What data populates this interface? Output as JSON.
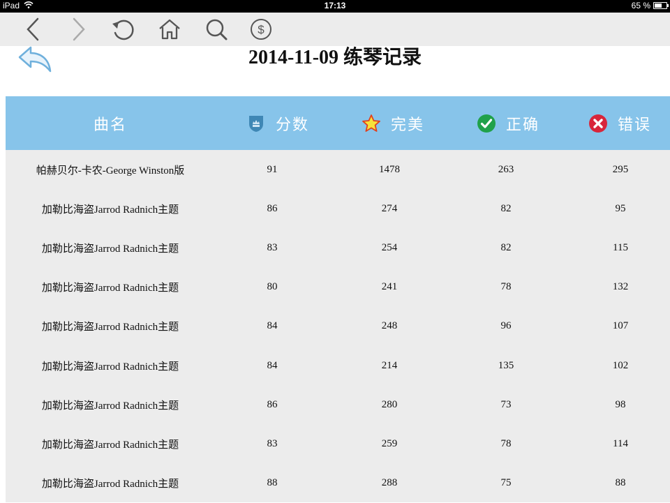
{
  "status_bar": {
    "device": "iPad",
    "time": "17:13",
    "battery": "65 %",
    "battery_level": 0.65
  },
  "toolbar": {
    "icons": [
      "back-icon",
      "forward-icon",
      "reload-icon",
      "home-icon",
      "search-icon",
      "dollar-icon"
    ]
  },
  "page": {
    "title": "2014-11-09 练琴记录"
  },
  "table": {
    "headers": {
      "name": "曲名",
      "score": "分数",
      "perfect": "完美",
      "correct": "正确",
      "error": "错误"
    },
    "rows": [
      {
        "name": "帕赫贝尔-卡农-George Winston版",
        "score": "91",
        "perfect": "1478",
        "correct": "263",
        "error": "295"
      },
      {
        "name": "加勒比海盗Jarrod Radnich主题",
        "score": "86",
        "perfect": "274",
        "correct": "82",
        "error": "95"
      },
      {
        "name": "加勒比海盗Jarrod Radnich主题",
        "score": "83",
        "perfect": "254",
        "correct": "82",
        "error": "115"
      },
      {
        "name": "加勒比海盗Jarrod Radnich主题",
        "score": "80",
        "perfect": "241",
        "correct": "78",
        "error": "132"
      },
      {
        "name": "加勒比海盗Jarrod Radnich主题",
        "score": "84",
        "perfect": "248",
        "correct": "96",
        "error": "107"
      },
      {
        "name": "加勒比海盗Jarrod Radnich主题",
        "score": "84",
        "perfect": "214",
        "correct": "135",
        "error": "102"
      },
      {
        "name": "加勒比海盗Jarrod Radnich主题",
        "score": "86",
        "perfect": "280",
        "correct": "73",
        "error": "98"
      },
      {
        "name": "加勒比海盗Jarrod Radnich主题",
        "score": "83",
        "perfect": "259",
        "correct": "78",
        "error": "114"
      },
      {
        "name": "加勒比海盗Jarrod Radnich主题",
        "score": "88",
        "perfect": "288",
        "correct": "75",
        "error": "88"
      }
    ]
  },
  "colors": {
    "header_bg": "#87c4ea",
    "table_bg": "#ececec",
    "toolbar_bg": "#ececec"
  }
}
